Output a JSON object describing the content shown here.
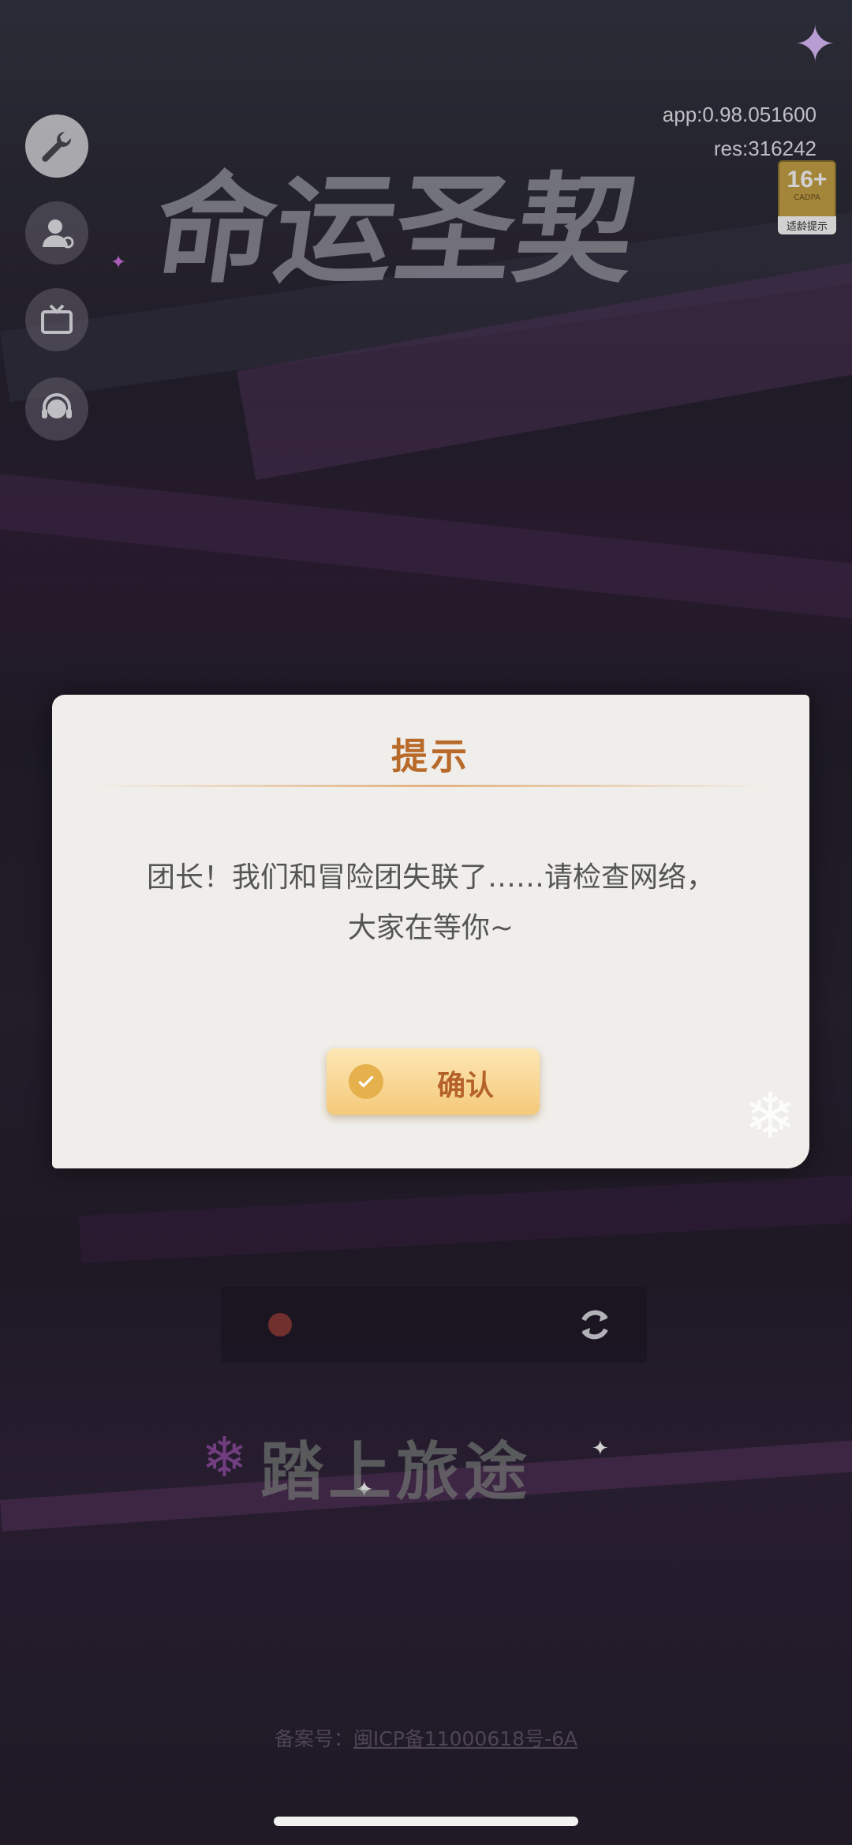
{
  "version": {
    "app": "app:0.98.051600",
    "res": "res:316242"
  },
  "age_badge": {
    "rating": "16+",
    "org": "CADPA",
    "caption": "适龄提示"
  },
  "logo_text": "命运圣契",
  "side_icons": [
    {
      "name": "wrench-icon"
    },
    {
      "name": "user-settings-icon"
    },
    {
      "name": "tv-icon"
    },
    {
      "name": "headset-icon"
    }
  ],
  "dialog": {
    "title": "提示",
    "message": "团长！我们和冒险团失联了……请检查网络，大家在等你~",
    "confirm_label": "确认"
  },
  "start_label": "踏上旅途",
  "icp": {
    "prefix": "备案号：",
    "number": "闽ICP备11000618号-6A"
  }
}
